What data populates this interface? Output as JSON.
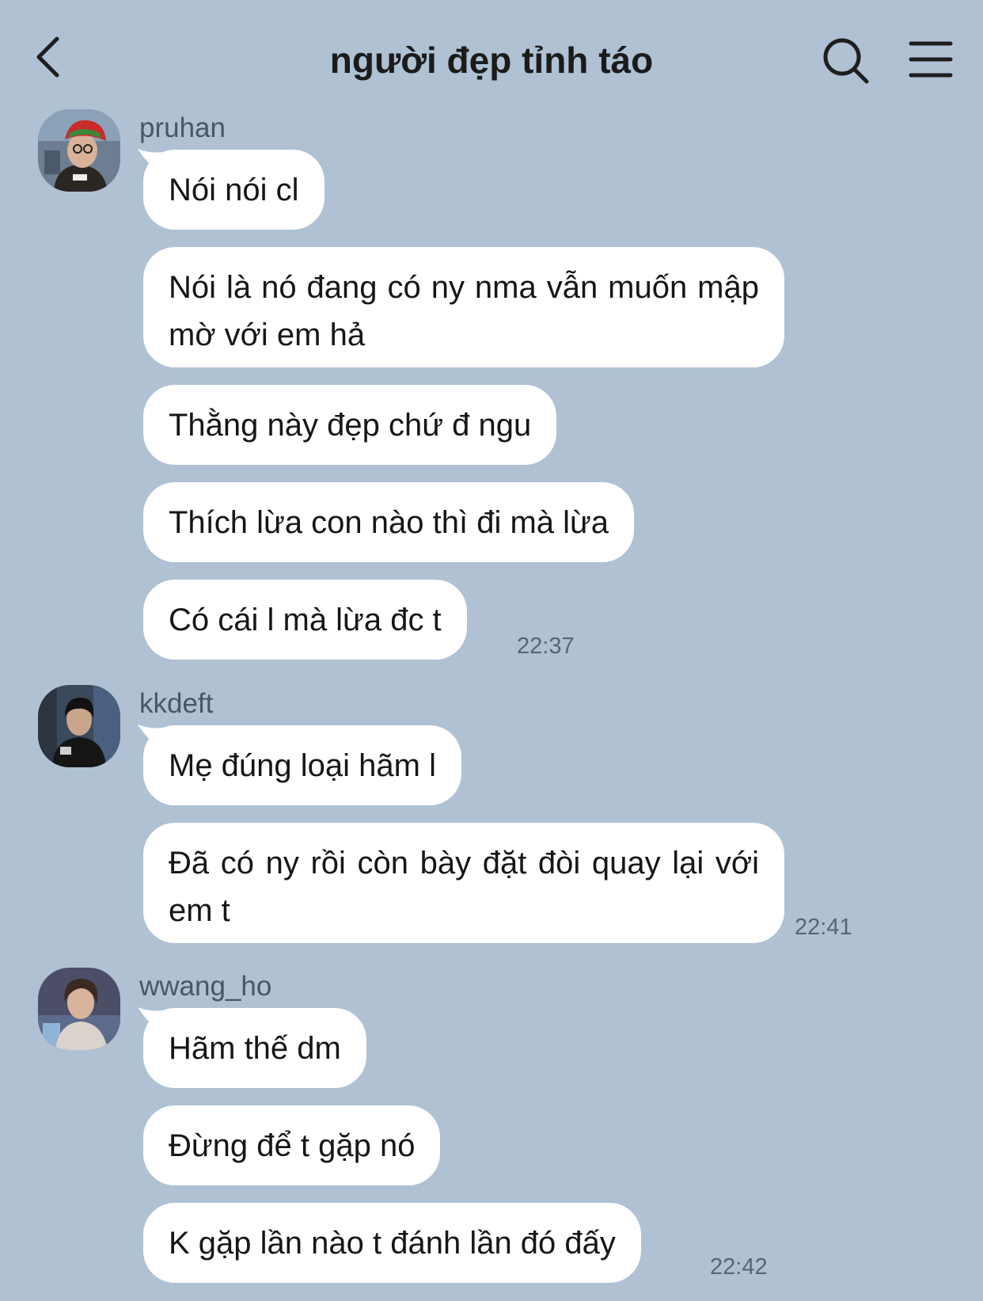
{
  "header": {
    "title": "người đẹp tỉnh táo",
    "back_icon": "chevron-left-icon",
    "search_icon": "search-icon",
    "menu_icon": "hamburger-menu-icon"
  },
  "colors": {
    "background": "#afc1d3",
    "bubble": "#ffffff",
    "text": "#161616"
  },
  "messages": [
    {
      "sender": "pruhan",
      "bubbles": [
        "Nói nói cl",
        "Nói là nó đang có ny nma vẫn muốn mập mờ với em hả",
        "Thằng này đẹp chứ đ ngu",
        "Thích lừa con nào thì đi mà lừa",
        "Có cái l mà lừa đc t"
      ],
      "time": "22:37"
    },
    {
      "sender": "kkdeft",
      "bubbles": [
        "Mẹ đúng loại hãm l",
        "Đã có ny rồi còn bày đặt đòi quay lại với em t"
      ],
      "time": "22:41"
    },
    {
      "sender": "wwang_ho",
      "bubbles": [
        "Hãm thế dm",
        "Đừng để t gặp nó",
        "K gặp lần nào t đánh lần đó đấy"
      ],
      "time": "22:42"
    }
  ]
}
